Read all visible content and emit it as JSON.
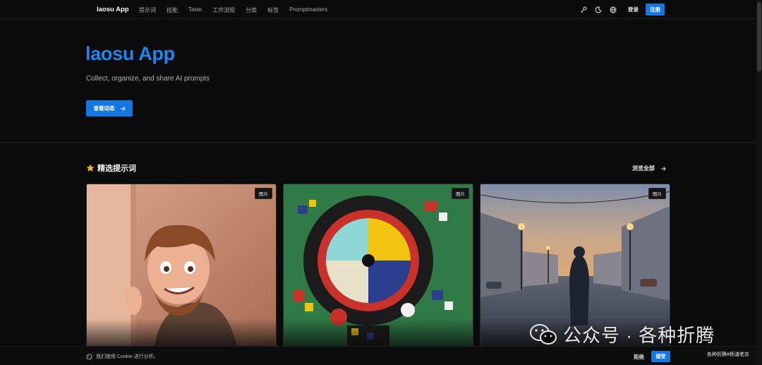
{
  "nav": {
    "brand": "laosu App",
    "links": [
      "提示词",
      "技能",
      "Taste",
      "工作流程",
      "分类",
      "标签",
      "Promptmasters"
    ],
    "login_label": "登录",
    "register_label": "注册",
    "icons": [
      "key-icon",
      "moon-icon",
      "globe-icon"
    ]
  },
  "hero": {
    "title": "laosu App",
    "subtitle": "Collect, organize, and share AI prompts",
    "button_label": "查看动态"
  },
  "featured": {
    "title": "精选提示词",
    "view_all_label": "浏览全部",
    "cards": [
      {
        "badge": "图片"
      },
      {
        "badge": "图片"
      },
      {
        "badge": "图片"
      }
    ]
  },
  "cookie": {
    "text": "我们使用 Cookie 进行分析。",
    "decline_label": "拒绝",
    "accept_label": "接受"
  },
  "watermark": {
    "text": "公众号 · 各种折腾",
    "author": "各种折腾#杨浦老苏"
  },
  "colors": {
    "accent": "#1477e6",
    "title_blue": "#1c86f2",
    "background": "#0b0b0c",
    "star": "#f2b51c"
  }
}
